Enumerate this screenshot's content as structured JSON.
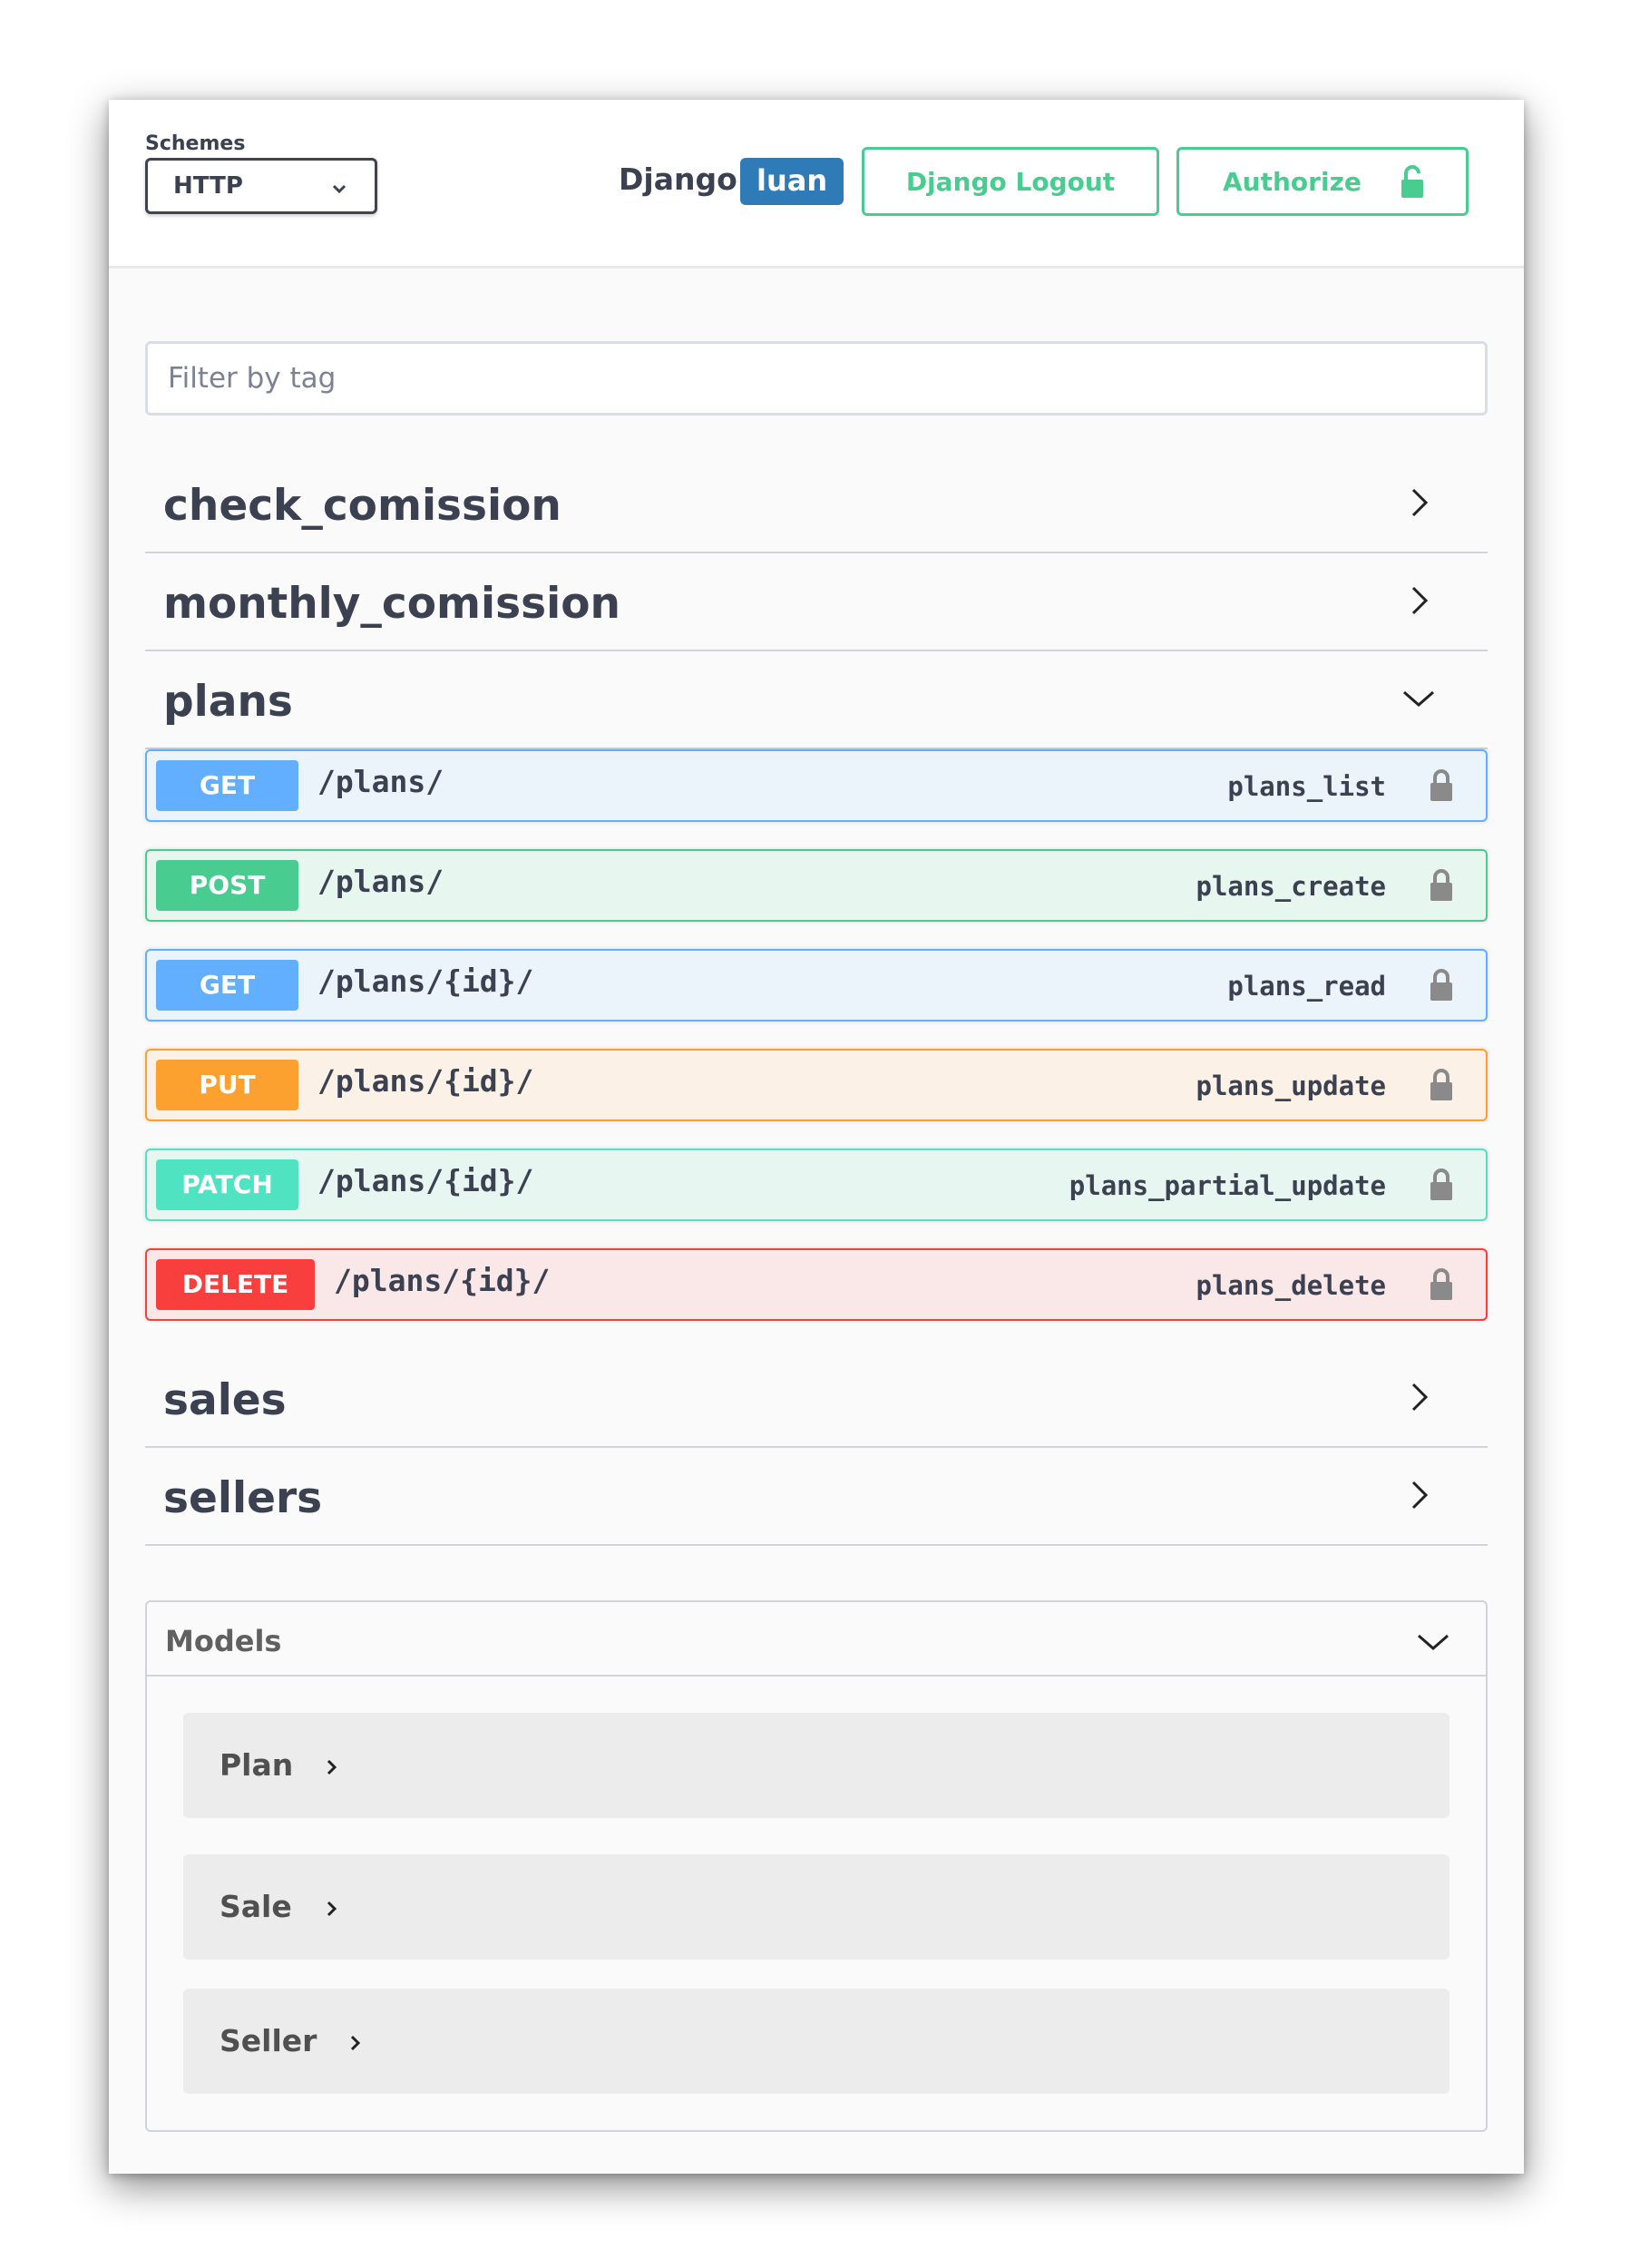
{
  "topbar": {
    "schemes_label": "Schemes",
    "scheme_selected": "HTTP",
    "django_label": "Django",
    "username": "luan",
    "logout_label": "Django Logout",
    "authorize_label": "Authorize"
  },
  "filter": {
    "placeholder": "Filter by tag"
  },
  "tags": [
    {
      "name": "check_comission",
      "expanded": false
    },
    {
      "name": "monthly_comission",
      "expanded": false
    },
    {
      "name": "plans",
      "expanded": true
    },
    {
      "name": "sales",
      "expanded": false
    },
    {
      "name": "sellers",
      "expanded": false
    }
  ],
  "operations": [
    {
      "method": "GET",
      "path": "/plans/",
      "operation_id": "plans_list"
    },
    {
      "method": "POST",
      "path": "/plans/",
      "operation_id": "plans_create"
    },
    {
      "method": "GET",
      "path": "/plans/{id}/",
      "operation_id": "plans_read"
    },
    {
      "method": "PUT",
      "path": "/plans/{id}/",
      "operation_id": "plans_update"
    },
    {
      "method": "PATCH",
      "path": "/plans/{id}/",
      "operation_id": "plans_partial_update"
    },
    {
      "method": "DELETE",
      "path": "/plans/{id}/",
      "operation_id": "plans_delete"
    }
  ],
  "models": {
    "title": "Models",
    "items": [
      {
        "name": "Plan"
      },
      {
        "name": "Sale"
      },
      {
        "name": "Seller"
      }
    ]
  },
  "colors": {
    "get": "#61affe",
    "post": "#49cc90",
    "put": "#fca130",
    "patch": "#50e3c2",
    "delete": "#f93e3e",
    "user_badge": "#2f7bb7"
  },
  "icons": {
    "scheme_dropdown": "chevron-down-icon",
    "authorize": "unlock-icon",
    "operation_lock": "lock-icon",
    "tag_collapsed": "chevron-right-icon",
    "tag_expanded": "chevron-down-icon"
  }
}
